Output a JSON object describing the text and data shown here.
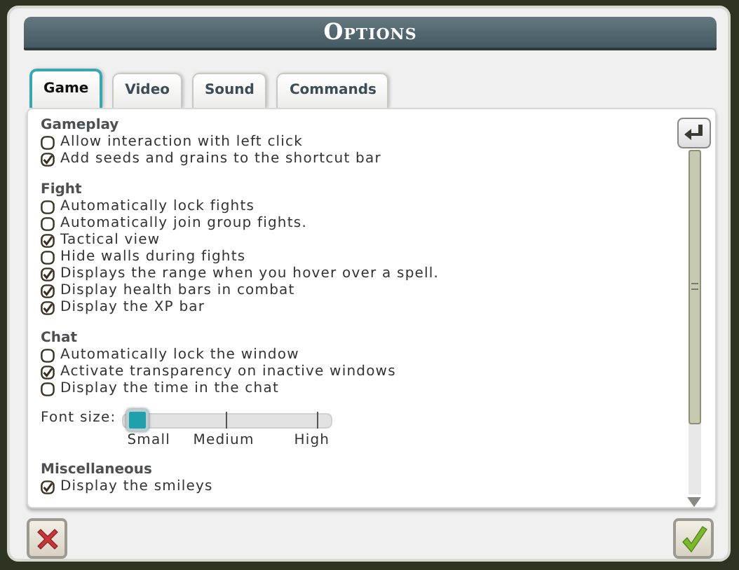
{
  "window": {
    "title": "Options"
  },
  "tabs": [
    {
      "label": "Game",
      "selected": true
    },
    {
      "label": "Video",
      "selected": false
    },
    {
      "label": "Sound",
      "selected": false
    },
    {
      "label": "Commands",
      "selected": false
    }
  ],
  "sections": [
    {
      "heading": "Gameplay",
      "items": [
        {
          "kind": "checkbox",
          "label": "Allow interaction with left click",
          "checked": false
        },
        {
          "kind": "checkbox",
          "label": "Add seeds and grains to the shortcut bar",
          "checked": true
        }
      ]
    },
    {
      "heading": "Fight",
      "items": [
        {
          "kind": "checkbox",
          "label": "Automatically lock fights",
          "checked": false
        },
        {
          "kind": "checkbox",
          "label": "Automatically join group fights.",
          "checked": false
        },
        {
          "kind": "checkbox",
          "label": "Tactical view",
          "checked": true
        },
        {
          "kind": "checkbox",
          "label": "Hide walls during fights",
          "checked": false
        },
        {
          "kind": "checkbox",
          "label": "Displays the range when you hover over a spell.",
          "checked": true
        },
        {
          "kind": "checkbox",
          "label": "Display health bars in combat",
          "checked": true
        },
        {
          "kind": "checkbox",
          "label": "Display the XP bar",
          "checked": true
        }
      ]
    },
    {
      "heading": "Chat",
      "items": [
        {
          "kind": "checkbox",
          "label": "Automatically lock the window",
          "checked": false
        },
        {
          "kind": "checkbox",
          "label": "Activate transparency on inactive windows",
          "checked": true
        },
        {
          "kind": "checkbox",
          "label": "Display the time in the chat",
          "checked": false
        },
        {
          "kind": "slider",
          "label": "Font size:",
          "level": 0,
          "stops": [
            "Small",
            "Medium",
            "High"
          ]
        }
      ]
    },
    {
      "heading": "Miscellaneous",
      "items": [
        {
          "kind": "checkbox",
          "label": "Display the smileys",
          "checked": true
        }
      ]
    }
  ]
}
